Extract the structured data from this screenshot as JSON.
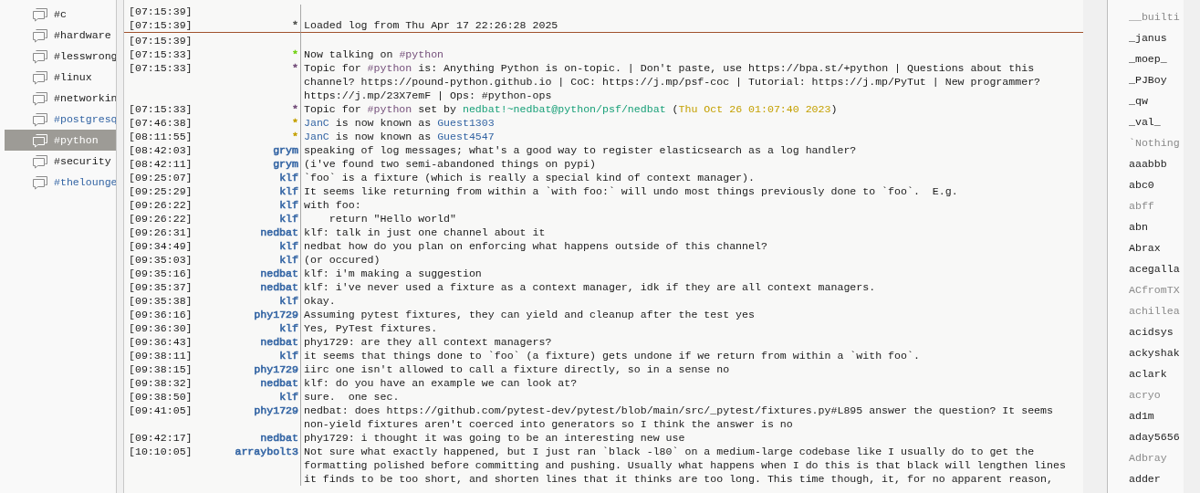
{
  "channels": [
    {
      "name": "#c",
      "selected": false,
      "unread": false
    },
    {
      "name": "#hardware",
      "selected": false,
      "unread": false
    },
    {
      "name": "#lesswrong",
      "selected": false,
      "unread": false
    },
    {
      "name": "#linux",
      "selected": false,
      "unread": false
    },
    {
      "name": "#networkin",
      "selected": false,
      "unread": false
    },
    {
      "name": "#postgresq",
      "selected": false,
      "unread": true
    },
    {
      "name": "#python",
      "selected": true,
      "unread": false
    },
    {
      "name": "#security",
      "selected": false,
      "unread": false
    },
    {
      "name": "#thelounge",
      "selected": false,
      "unread": true
    }
  ],
  "chat": [
    {
      "kind": "line",
      "time": "[07:15:39]"
    },
    {
      "kind": "line",
      "time": "[07:15:39]",
      "prefix": {
        "text": "*",
        "color": "#555753"
      },
      "text": "Loaded log from Thu Apr 17 22:26:28 2025"
    },
    {
      "kind": "marker"
    },
    {
      "kind": "line",
      "time": "[07:15:39]"
    },
    {
      "kind": "line",
      "time": "[07:15:33]",
      "prefix": {
        "text": "*",
        "color": "#73d216"
      },
      "parts": [
        {
          "kind": "plain",
          "text": "Now talking on "
        },
        {
          "kind": "channel",
          "text": "#python"
        }
      ]
    },
    {
      "kind": "line",
      "time": "[07:15:33]",
      "prefix": {
        "text": "*",
        "color": "#75507b"
      },
      "parts": [
        {
          "kind": "plain",
          "text": "Topic for "
        },
        {
          "kind": "channel",
          "text": "#python"
        },
        {
          "kind": "plain",
          "text": " is: Anything Python is on-topic. | Don't paste, use https://bpa.st/+python | Questions about this channel? https://pound-python.github.io | CoC: https://j.mp/psf-coc | Tutorial: https://j.mp/PyTut | New programmer? https://j.mp/23X7emF | Ops: #python-ops"
        }
      ]
    },
    {
      "kind": "line",
      "time": "[07:15:33]",
      "prefix": {
        "text": "*",
        "color": "#75507b"
      },
      "parts": [
        {
          "kind": "plain",
          "text": "Topic for "
        },
        {
          "kind": "channel",
          "text": "#python"
        },
        {
          "kind": "plain",
          "text": " set by "
        },
        {
          "kind": "host",
          "text": "nedbat!~nedbat@python/psf/nedbat"
        },
        {
          "kind": "plain",
          "text": " ("
        },
        {
          "kind": "date",
          "text": "Thu Oct 26 01:07:40 2023"
        },
        {
          "kind": "plain",
          "text": ")"
        }
      ]
    },
    {
      "kind": "line",
      "time": "[07:46:38]",
      "prefix": {
        "text": "*",
        "color": "#c4a000"
      },
      "parts": [
        {
          "kind": "nick",
          "text": "JanC"
        },
        {
          "kind": "plain",
          "text": " is now known as "
        },
        {
          "kind": "nick",
          "text": "Guest1303"
        }
      ]
    },
    {
      "kind": "line",
      "time": "[08:11:55]",
      "prefix": {
        "text": "*",
        "color": "#c4a000"
      },
      "parts": [
        {
          "kind": "nick",
          "text": "JanC"
        },
        {
          "kind": "plain",
          "text": " is now known as "
        },
        {
          "kind": "nick",
          "text": "Guest4547"
        }
      ]
    },
    {
      "kind": "line",
      "time": "[08:42:03]",
      "prefix": {
        "text": "grym",
        "color": "#3465a4"
      },
      "text": "speaking of log messages; what's a good way to register elasticsearch as a log handler?"
    },
    {
      "kind": "line",
      "time": "[08:42:11]",
      "prefix": {
        "text": "grym",
        "color": "#3465a4"
      },
      "text": "(i've found two semi-abandoned things on pypi)"
    },
    {
      "kind": "line",
      "time": "[09:25:07]",
      "prefix": {
        "text": "klf",
        "color": "#3465a4"
      },
      "text": "`foo` is a fixture (which is really a special kind of context manager)."
    },
    {
      "kind": "line",
      "time": "[09:25:29]",
      "prefix": {
        "text": "klf",
        "color": "#3465a4"
      },
      "text": "It seems like returning from within a `with foo:` will undo most things previously done to `foo`.  E.g."
    },
    {
      "kind": "line",
      "time": "[09:26:22]",
      "prefix": {
        "text": "klf",
        "color": "#3465a4"
      },
      "text": "with foo:"
    },
    {
      "kind": "line",
      "time": "[09:26:22]",
      "prefix": {
        "text": "klf",
        "color": "#3465a4"
      },
      "text": "    return \"Hello world\""
    },
    {
      "kind": "line",
      "time": "[09:26:31]",
      "prefix": {
        "text": "nedbat",
        "color": "#3465a4"
      },
      "text": "klf: talk in just one channel about it"
    },
    {
      "kind": "line",
      "time": "[09:34:49]",
      "prefix": {
        "text": "klf",
        "color": "#3465a4"
      },
      "text": "nedbat how do you plan on enforcing what happens outside of this channel?"
    },
    {
      "kind": "line",
      "time": "[09:35:03]",
      "prefix": {
        "text": "klf",
        "color": "#3465a4"
      },
      "text": "(or occured)"
    },
    {
      "kind": "line",
      "time": "[09:35:16]",
      "prefix": {
        "text": "nedbat",
        "color": "#3465a4"
      },
      "text": "klf: i'm making a suggestion"
    },
    {
      "kind": "line",
      "time": "[09:35:37]",
      "prefix": {
        "text": "nedbat",
        "color": "#3465a4"
      },
      "text": "klf: i've never used a fixture as a context manager, idk if they are all context managers."
    },
    {
      "kind": "line",
      "time": "[09:35:38]",
      "prefix": {
        "text": "klf",
        "color": "#3465a4"
      },
      "text": "okay."
    },
    {
      "kind": "line",
      "time": "[09:36:16]",
      "prefix": {
        "text": "phy1729",
        "color": "#3465a4"
      },
      "text": "Assuming pytest fixtures, they can yield and cleanup after the test yes"
    },
    {
      "kind": "line",
      "time": "[09:36:30]",
      "prefix": {
        "text": "klf",
        "color": "#3465a4"
      },
      "text": "Yes, PyTest fixtures."
    },
    {
      "kind": "line",
      "time": "[09:36:43]",
      "prefix": {
        "text": "nedbat",
        "color": "#3465a4"
      },
      "text": "phy1729: are they all context managers?"
    },
    {
      "kind": "line",
      "time": "[09:38:11]",
      "prefix": {
        "text": "klf",
        "color": "#3465a4"
      },
      "text": "it seems that things done to `foo` (a fixture) gets undone if we return from within a `with foo`."
    },
    {
      "kind": "line",
      "time": "[09:38:15]",
      "prefix": {
        "text": "phy1729",
        "color": "#3465a4"
      },
      "text": "iirc one isn't allowed to call a fixture directly, so in a sense no"
    },
    {
      "kind": "line",
      "time": "[09:38:32]",
      "prefix": {
        "text": "nedbat",
        "color": "#3465a4"
      },
      "text": "klf: do you have an example we can look at?"
    },
    {
      "kind": "line",
      "time": "[09:38:50]",
      "prefix": {
        "text": "klf",
        "color": "#3465a4"
      },
      "text": "sure.  one sec."
    },
    {
      "kind": "line",
      "time": "[09:41:05]",
      "prefix": {
        "text": "phy1729",
        "color": "#3465a4"
      },
      "text": "nedbat: does https://github.com/pytest-dev/pytest/blob/main/src/_pytest/fixtures.py#L895 answer the question? It seems non-yield fixtures aren't coerced into generators so I think the answer is no"
    },
    {
      "kind": "line",
      "time": "[09:42:17]",
      "prefix": {
        "text": "nedbat",
        "color": "#3465a4"
      },
      "text": "phy1729: i thought it was going to be an interesting new use"
    },
    {
      "kind": "line",
      "time": "[10:10:05]",
      "prefix": {
        "text": "arraybolt3",
        "color": "#3465a4"
      },
      "text": "Not sure what exactly happened, but I just ran `black -l80` on a medium-large codebase like I usually do to get the formatting polished before committing and pushing. Usually what happens when I do this is that black will lengthen lines it finds to be too short, and shorten lines that it thinks are too long. This time though, it, for no apparent reason,"
    }
  ],
  "users": [
    {
      "nick": "__builti",
      "away": true
    },
    {
      "nick": "_janus",
      "away": false
    },
    {
      "nick": "_moep_",
      "away": false
    },
    {
      "nick": "_PJBoy",
      "away": false
    },
    {
      "nick": "_qw",
      "away": false
    },
    {
      "nick": "_val_",
      "away": false
    },
    {
      "nick": "`Nothing",
      "away": true
    },
    {
      "nick": "aaabbb",
      "away": false
    },
    {
      "nick": "abc0",
      "away": false
    },
    {
      "nick": "abff",
      "away": true
    },
    {
      "nick": "abn",
      "away": false
    },
    {
      "nick": "Abrax",
      "away": false
    },
    {
      "nick": "acegalla",
      "away": false
    },
    {
      "nick": "ACfromTX",
      "away": true
    },
    {
      "nick": "achillea",
      "away": true
    },
    {
      "nick": "acidsys",
      "away": false
    },
    {
      "nick": "ackyshak",
      "away": false
    },
    {
      "nick": "aclark",
      "away": false
    },
    {
      "nick": "acryo",
      "away": true
    },
    {
      "nick": "ad1m",
      "away": false
    },
    {
      "nick": "aday5656",
      "away": false
    },
    {
      "nick": "Adbray",
      "away": true
    },
    {
      "nick": "adder",
      "away": false
    }
  ]
}
